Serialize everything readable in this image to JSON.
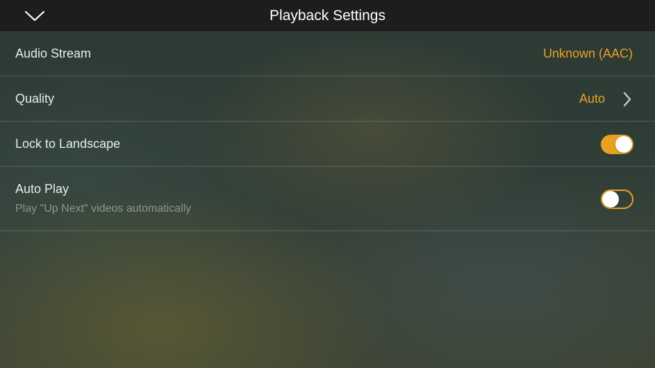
{
  "header": {
    "title": "Playback Settings",
    "collapse_icon": "chevron-down-icon"
  },
  "colors": {
    "accent": "#e9a124",
    "header_background": "#1c1c1a",
    "label_text": "#e9ece8"
  },
  "settings": {
    "audio_stream": {
      "label": "Audio Stream",
      "value": "Unknown (AAC)"
    },
    "quality": {
      "label": "Quality",
      "value": "Auto",
      "icon": "chevron-right-icon"
    },
    "lock_landscape": {
      "label": "Lock to Landscape",
      "enabled": true
    },
    "auto_play": {
      "label": "Auto Play",
      "description": "Play \"Up Next\" videos automatically",
      "enabled": false
    }
  }
}
